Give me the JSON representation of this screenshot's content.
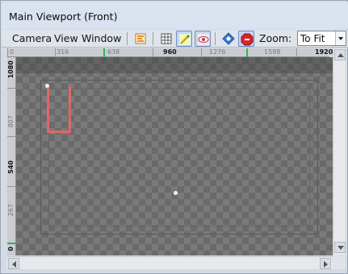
{
  "window": {
    "title": "Main Viewport (Front)"
  },
  "menubar": {
    "menus": [
      "Camera",
      "View",
      "Window"
    ],
    "zoom_label": "Zoom:",
    "zoom_value": "To Fit"
  },
  "toolbar": {
    "buttons": [
      {
        "icon": "timeline-icon",
        "active": false
      },
      {
        "icon": "grid-icon",
        "active": false
      },
      {
        "icon": "brush-icon",
        "active": true
      },
      {
        "icon": "eye-icon",
        "active": true
      },
      {
        "icon": "target-icon",
        "active": false
      },
      {
        "icon": "stop-icon",
        "active": true
      }
    ]
  },
  "rulers": {
    "horizontal_labels": [
      "0",
      "316",
      "638",
      "960",
      "1276",
      "1598",
      "1920"
    ],
    "vertical_labels": [
      "1080",
      "807",
      "540",
      "267",
      "0"
    ],
    "accent_color": "#2fb54a"
  },
  "viewport": {
    "selection_color": "#e06666"
  }
}
